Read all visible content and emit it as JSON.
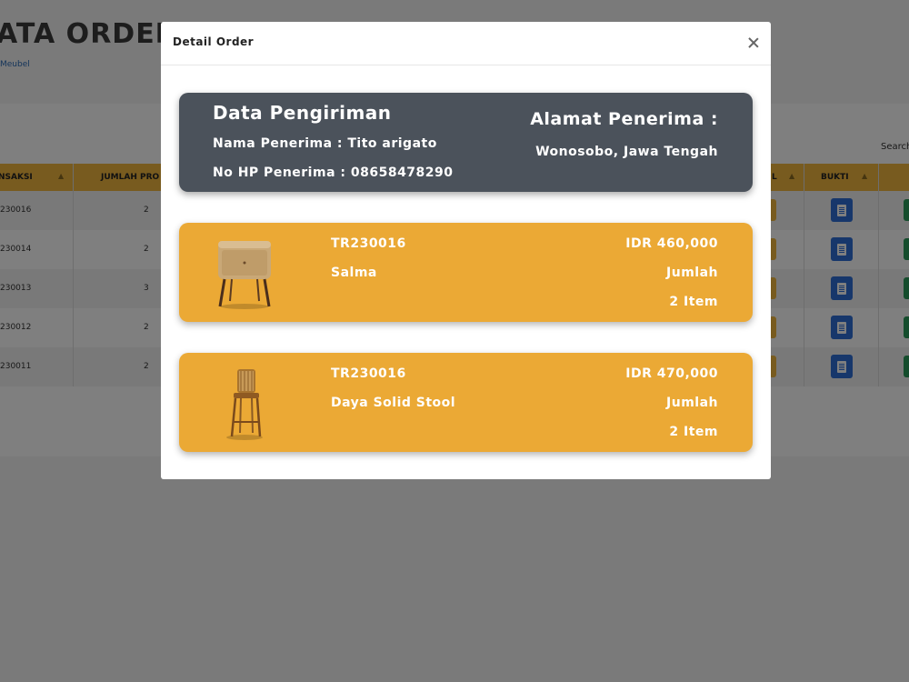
{
  "background": {
    "page_title": "ATA ORDER",
    "page_subtitle": "Meubel",
    "search_label": "Search",
    "columns": [
      "NSAKSI",
      "JUMLAH PRO",
      "L",
      "BUKTI"
    ],
    "rows": [
      {
        "id": "230016",
        "qty": "2"
      },
      {
        "id": "230014",
        "qty": "2"
      },
      {
        "id": "230013",
        "qty": "3"
      },
      {
        "id": "230012",
        "qty": "2"
      },
      {
        "id": "230011",
        "qty": "2"
      }
    ]
  },
  "modal": {
    "title": "Detail Order",
    "shipping": {
      "heading": "Data Pengiriman",
      "recipient_line": "Nama Penerima : Tito arigato",
      "phone_line": "No HP Penerima : 08658478290",
      "address_heading": "Alamat Penerima :",
      "address_value": "Wonosobo, Jawa Tengah"
    },
    "items": [
      {
        "code": "TR230016",
        "name": "Salma",
        "price": "IDR 460,000",
        "qty_label": "Jumlah",
        "qty": "2 Item",
        "image": "nightstand-image"
      },
      {
        "code": "TR230016",
        "name": "Daya Solid Stool",
        "price": "IDR 470,000",
        "qty_label": "Jumlah",
        "qty": "2 Item",
        "image": "bar-stool-image"
      }
    ]
  },
  "colors": {
    "accent": "#eba935",
    "card_dark": "#4b525b",
    "table_header": "#f0b63f",
    "bukti_button": "#2f6fd6",
    "action_button": "#2a9b5a"
  }
}
